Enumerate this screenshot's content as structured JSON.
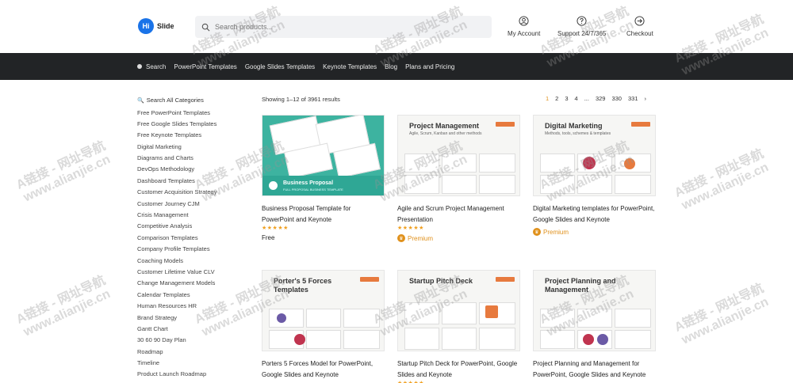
{
  "header": {
    "logo_badge": "Hi",
    "logo_text": "Slide",
    "search_placeholder": "Search products...",
    "actions": [
      {
        "label": "My Account",
        "icon": "user-icon"
      },
      {
        "label": "Support 24/7/365",
        "icon": "help-icon"
      },
      {
        "label": "Checkout",
        "icon": "checkout-arrow-icon"
      }
    ]
  },
  "nav": {
    "items": [
      "Search",
      "PowerPoint Templates",
      "Google Slides Templates",
      "Keynote Templates",
      "Blog",
      "Plans and Pricing"
    ]
  },
  "sidebar": {
    "heading": "Search All Categories",
    "items": [
      "Free PowerPoint Templates",
      "Free Google Slides Templates",
      "Free Keynote Templates",
      "Digital Marketing",
      "Diagrams and Charts",
      "DevOps Methodology",
      "Dashboard Templates",
      "Customer Acquisition Strategy",
      "Customer Journey CJM",
      "Crisis Management",
      "Competitive Analysis",
      "Comparison Templates",
      "Company Profile Templates",
      "Coaching Models",
      "Customer Lifetime Value CLV",
      "Change Management Models",
      "Calendar Templates",
      "Human Resources HR",
      "Brand Strategy",
      "Gantt Chart",
      "30 60 90 Day Plan",
      "Roadmap",
      "Timeline",
      "Product Launch Roadmap"
    ]
  },
  "results": {
    "showing": "Showing 1–12 of 3961 results",
    "pages": [
      "1",
      "2",
      "3",
      "4",
      "...",
      "329",
      "330",
      "331",
      "›"
    ],
    "active_page": "1"
  },
  "products": [
    {
      "title": "Business Proposal Template for PowerPoint and Keynote",
      "thumb_title": "Business Proposal",
      "thumb_sub": "FULL PROPOSAL BUSINESS TEMPLATE",
      "stars": "★★★★★",
      "price": "Free"
    },
    {
      "title": "Agile and Scrum Project Management Presentation",
      "thumb_title": "Project Management",
      "thumb_sub": "Agile, Scrum, Kanban and other methods",
      "stars": "★★★★★",
      "price": "Premium"
    },
    {
      "title": "Digital Marketing templates for PowerPoint, Google Slides and Keynote",
      "thumb_title": "Digital Marketing",
      "thumb_sub": "Methods, tools, schemes & templates",
      "stars": "",
      "price": "Premium"
    },
    {
      "title": "Porters 5 Forces Model for PowerPoint, Google Slides and Keynote",
      "thumb_title": "Porter's 5 Forces Templates",
      "thumb_sub": "",
      "stars": "",
      "price": ""
    },
    {
      "title": "Startup Pitch Deck for PowerPoint, Google Slides and Keynote",
      "thumb_title": "Startup Pitch Deck",
      "thumb_sub": "",
      "stars": "★★★★★",
      "price": ""
    },
    {
      "title": "Project Planning and Management for PowerPoint, Google Slides and Keynote",
      "thumb_title": "Project Planning and Management",
      "thumb_sub": "",
      "stars": "",
      "price": ""
    }
  ],
  "watermark": {
    "line1": "A链接 - 网址导航",
    "line2": "www.alianjie.cn"
  },
  "colors": {
    "nav_bg": "#222426",
    "accent": "#e0911c",
    "teal": "#3db3a0",
    "brand": "#1a73e8"
  }
}
